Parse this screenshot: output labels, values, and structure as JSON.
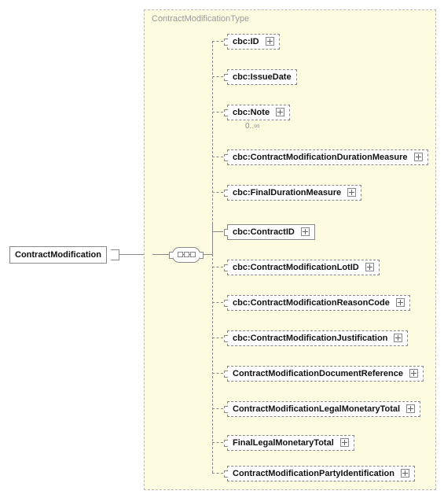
{
  "type_label": "ContractModificationType",
  "root": "ContractModification",
  "children": [
    {
      "label": "cbc:ID",
      "style": "dashed",
      "expand": true
    },
    {
      "label": "cbc:IssueDate",
      "style": "dashed",
      "expand": false
    },
    {
      "label": "cbc:Note",
      "style": "dashed",
      "expand": true,
      "occ": "0..∞"
    },
    {
      "label": "cbc:ContractModificationDurationMeasure",
      "style": "dashed",
      "expand": true
    },
    {
      "label": "cbc:FinalDurationMeasure",
      "style": "dashed",
      "expand": true
    },
    {
      "label": "cbc:ContractID",
      "style": "solid",
      "expand": true
    },
    {
      "label": "cbc:ContractModificationLotID",
      "style": "dashed",
      "expand": true
    },
    {
      "label": "cbc:ContractModificationReasonCode",
      "style": "dashed",
      "expand": true
    },
    {
      "label": "cbc:ContractModificationJustification",
      "style": "dashed",
      "expand": true
    },
    {
      "label": "ContractModificationDocumentReference",
      "style": "dashed",
      "expand": true
    },
    {
      "label": "ContractModificationLegalMonetaryTotal",
      "style": "dashed",
      "expand": true
    },
    {
      "label": "FinalLegalMonetaryTotal",
      "style": "dashed",
      "expand": true
    },
    {
      "label": "ContractModificationPartyIdentification",
      "style": "dashed",
      "expand": true
    }
  ],
  "chart_data": {
    "type": "tree",
    "root": "ContractModification",
    "complex_type": "ContractModificationType",
    "compositor": "sequence",
    "children": [
      {
        "name": "cbc:ID",
        "required": false,
        "expandable": true
      },
      {
        "name": "cbc:IssueDate",
        "required": false,
        "expandable": false
      },
      {
        "name": "cbc:Note",
        "required": false,
        "expandable": true,
        "minOccurs": 0,
        "maxOccurs": "unbounded"
      },
      {
        "name": "cbc:ContractModificationDurationMeasure",
        "required": false,
        "expandable": true
      },
      {
        "name": "cbc:FinalDurationMeasure",
        "required": false,
        "expandable": true
      },
      {
        "name": "cbc:ContractID",
        "required": true,
        "expandable": true
      },
      {
        "name": "cbc:ContractModificationLotID",
        "required": false,
        "expandable": true
      },
      {
        "name": "cbc:ContractModificationReasonCode",
        "required": false,
        "expandable": true
      },
      {
        "name": "cbc:ContractModificationJustification",
        "required": false,
        "expandable": true
      },
      {
        "name": "ContractModificationDocumentReference",
        "required": false,
        "expandable": true
      },
      {
        "name": "ContractModificationLegalMonetaryTotal",
        "required": false,
        "expandable": true
      },
      {
        "name": "FinalLegalMonetaryTotal",
        "required": false,
        "expandable": true
      },
      {
        "name": "ContractModificationPartyIdentification",
        "required": false,
        "expandable": true
      }
    ]
  }
}
